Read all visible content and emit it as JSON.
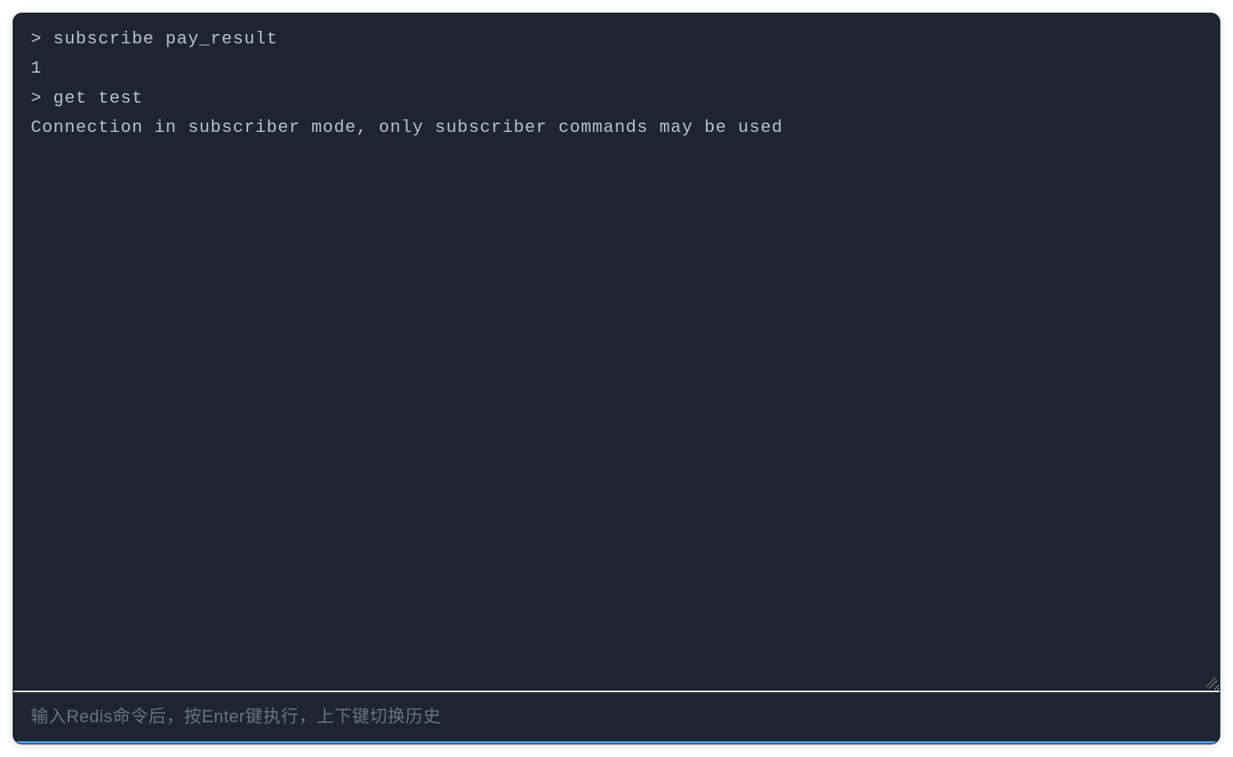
{
  "terminal": {
    "lines": [
      {
        "type": "prompt",
        "text": "> subscribe pay_result"
      },
      {
        "type": "output",
        "text": "1"
      },
      {
        "type": "prompt",
        "text": "> get test"
      },
      {
        "type": "output",
        "text": "Connection in subscriber mode, only subscriber commands may be used"
      }
    ]
  },
  "input": {
    "placeholder": "输入Redis命令后，按Enter键执行，上下键切换历史",
    "value": ""
  }
}
